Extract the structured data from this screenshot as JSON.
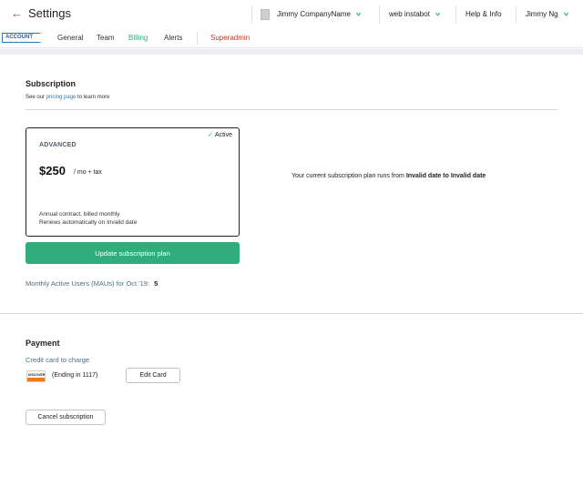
{
  "header": {
    "title": "Settings",
    "company": "Jimmy CompanyName",
    "bot": "web instabot",
    "help": "Help & Info",
    "user": "Jimmy Ng"
  },
  "tabs": {
    "account_badge": "ACCOUNT",
    "items": [
      "General",
      "Team",
      "Billing",
      "Alerts",
      "Superadmin"
    ],
    "active": "Billing"
  },
  "subscription": {
    "heading": "Subscription",
    "see_prefix": "See our ",
    "pricing_link": "pricing page",
    "see_suffix": " to learn more",
    "active_label": "Active",
    "plan_name": "ADVANCED",
    "price": "$250",
    "price_unit": "/ mo + tax",
    "contract_line1": "Annual contract, billed monthly",
    "contract_line2": "Renews automatically on Invalid date",
    "update_button": "Update subscription plan",
    "period_prefix": "Your current subscription plan runs from ",
    "period_value": "Invalid date to Invalid date",
    "mau_label": "Monthly Active Users (MAUs) for Oct '19:",
    "mau_value": "5"
  },
  "payment": {
    "heading": "Payment",
    "cc_label": "Credit card to charge",
    "card_brand": "DISCOVER",
    "ending": "(Ending in 1117)",
    "edit_button": "Edit Card",
    "cancel_button": "Cancel subscription"
  },
  "colors": {
    "accent": "#2fae7b",
    "link": "#2a7bb8",
    "superadmin": "#c0392b"
  }
}
